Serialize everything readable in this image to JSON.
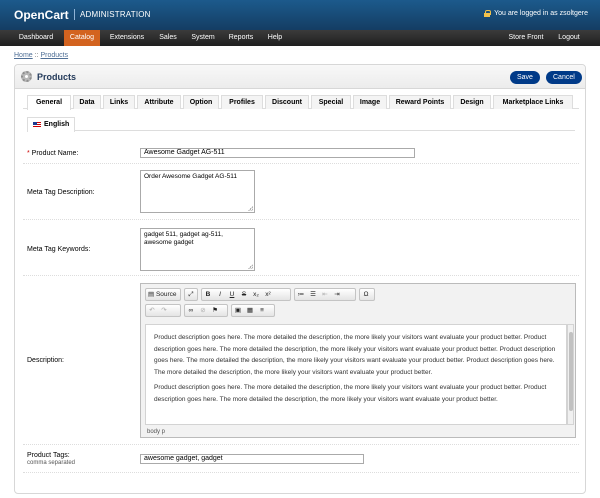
{
  "header": {
    "logo": "OpenCart",
    "admin": "ADMINISTRATION",
    "logged_in": "You are logged in as zsoltgere"
  },
  "menu": {
    "items": [
      "Dashboard",
      "Catalog",
      "Extensions",
      "Sales",
      "System",
      "Reports",
      "Help"
    ],
    "right": [
      "Store Front",
      "Logout"
    ],
    "active": "Catalog",
    "active_color": "#d3631f"
  },
  "breadcrumb": {
    "home": "Home",
    "sep": " :: ",
    "current": "Products"
  },
  "page": {
    "title": "Products",
    "save": "Save",
    "cancel": "Cancel",
    "button_color": "#003a88"
  },
  "tabs": [
    "General",
    "Data",
    "Links",
    "Attribute",
    "Option",
    "Profiles",
    "Discount",
    "Special",
    "Image",
    "Reward Points",
    "Design",
    "Marketplace Links"
  ],
  "language_tab": "English",
  "form": {
    "product_name": {
      "label": "Product Name:",
      "required": "* ",
      "value": "Awesome Gadget AG-511"
    },
    "meta_description": {
      "label": "Meta Tag Description:",
      "value": "Order Awesome Gadget AG-511"
    },
    "meta_keywords": {
      "label": "Meta Tag Keywords:",
      "value": "gadget 511, gadget ag-511, awesome gadget"
    },
    "description": {
      "label": "Description:",
      "paragraphs": [
        "Product description goes here. The more detailed the description, the more likely your visitors want evaluate your product better. Product description goes here. The more detailed the description, the more likely your visitors want evaluate your product better. Product description goes here. The more detailed the description, the more likely your visitors want evaluate your product better. Product description goes here. The more detailed the description, the more likely your visitors want evaluate your product better.",
        "Product description goes here. The more detailed the description, the more likely your visitors want evaluate your product better. Product description goes here. The more detailed the description, the more likely your visitors want evaluate your product better."
      ],
      "status": "body  p"
    },
    "tags": {
      "label": "Product Tags:",
      "sublabel": "comma separated",
      "value": "awesome gadget, gadget"
    }
  },
  "editor_toolbar": {
    "source": "Source",
    "icons": [
      "maximize-icon",
      "bold-icon",
      "italic-icon",
      "underline-icon",
      "strike-icon",
      "subscript-icon",
      "superscript-icon",
      "numbered-list-icon",
      "bulleted-list-icon",
      "outdent-icon",
      "indent-icon",
      "omega-icon",
      "undo-icon",
      "redo-icon",
      "link-icon",
      "unlink-icon",
      "anchor-icon",
      "image-icon",
      "table-icon",
      "horizontal-rule-icon"
    ]
  }
}
